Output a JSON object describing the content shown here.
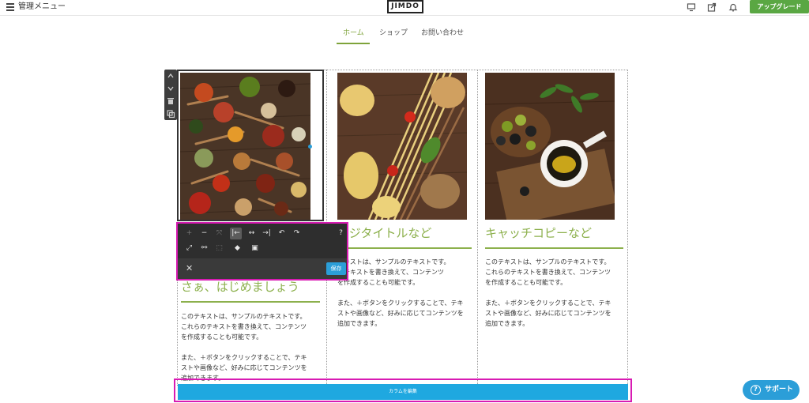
{
  "topbar": {
    "menu_label": "管理メニュー",
    "logo": "JIMDO",
    "upgrade_label": "アップグレード",
    "icons": [
      "hamburger-icon",
      "desktop-preview-icon",
      "share-icon",
      "bell-icon"
    ]
  },
  "nav": {
    "items": [
      "ホーム",
      "ショップ",
      "お問い合わせ"
    ],
    "active_index": 0,
    "active_color": "#7ea33a"
  },
  "columns": [
    {
      "photo": "spices",
      "heading": "さぁ、はじめましょう",
      "paragraphs": [
        "このテキストは、サンプルのテキストです。これらのテキストを書き換えて、コンテンツを作成することも可能です。",
        "また、＋ボタンをクリックすることで、テキストや画像など、好みに応じてコンテンツを追加できます。"
      ]
    },
    {
      "photo": "pasta",
      "heading": "ージタイトルなど",
      "paragraphs": [
        "テキストは、サンプルのテキストです。のテキストを書き換えて、コンテンツを作成することも可能です。",
        "また、＋ボタンをクリックすることで、テキストや画像など、好みに応じてコンテンツを追加できます。"
      ]
    },
    {
      "photo": "olives",
      "heading": "キャッチコピーなど",
      "paragraphs": [
        "このテキストは、サンプルのテキストです。これらのテキストを書き換えて、コンテンツを作成することも可能です。",
        "また、＋ボタンをクリックすることで、テキストや画像など、好みに応じてコンテンツを追加できます。"
      ]
    }
  ],
  "col2_lines": {
    "p1": [
      "テキストは、サンプルのテキストです。",
      "のテキストを書き換えて、コンテンツ",
      "を作成することも可能です。"
    ],
    "p2": [
      "また、＋ボタンをクリックすることで、テキ",
      "ストや画像など、好みに応じてコンテンツを",
      "追加できます。"
    ]
  },
  "col1_lines": {
    "p1": [
      "このテキストは、サンプルのテキストです。",
      "これらのテキストを書き換えて、コンテンツ",
      "を作成することも可能です。"
    ],
    "p2": [
      "また、＋ボタンをクリックすることで、テキ",
      "ストや画像など、好みに応じてコンテンツを",
      "追加できます。"
    ]
  },
  "col3_lines": {
    "p1": [
      "このテキストは、サンプルのテキストです。",
      "これらのテキストを書き換えて、コンテンツ",
      "を作成することも可能です。"
    ],
    "p2": [
      "また、＋ボタンをクリックすることで、テキ",
      "ストや画像など、好みに応じてコンテンツを",
      "追加できます。"
    ]
  },
  "side_toolbar": {
    "icons": [
      "move-up-icon",
      "move-down-icon",
      "delete-icon",
      "copy-icon"
    ]
  },
  "edit_toolbar": {
    "row1": [
      {
        "icon": "zoom-in-icon",
        "glyph": "+",
        "state": "disabled"
      },
      {
        "icon": "zoom-out-icon",
        "glyph": "−",
        "state": "normal"
      },
      {
        "icon": "fit-icon",
        "glyph": "⤧",
        "state": "disabled"
      },
      {
        "icon": "align-left-icon",
        "glyph": "|←",
        "state": "active"
      },
      {
        "icon": "align-center-icon",
        "glyph": "↔",
        "state": "normal"
      },
      {
        "icon": "align-right-icon",
        "glyph": "→|",
        "state": "normal"
      },
      {
        "icon": "rotate-left-icon",
        "glyph": "↶",
        "state": "normal"
      },
      {
        "icon": "rotate-right-icon",
        "glyph": "↷",
        "state": "normal"
      },
      {
        "icon": "help-icon",
        "glyph": "?",
        "state": "normal"
      }
    ],
    "row2": [
      {
        "icon": "resize-icon",
        "glyph": "⤢",
        "state": "normal"
      },
      {
        "icon": "link-icon",
        "glyph": "⚯",
        "state": "normal"
      },
      {
        "icon": "crop-icon",
        "glyph": "⬚",
        "state": "disabled"
      },
      {
        "icon": "tag-icon",
        "glyph": "◆",
        "state": "normal"
      },
      {
        "icon": "caption-icon",
        "glyph": "▣",
        "state": "normal"
      }
    ],
    "close_glyph": "✕",
    "save_label": "保存"
  },
  "column_edit_label": "カラムを編集",
  "support_label": "サポート",
  "support_glyph": "?",
  "accent_colors": {
    "green": "#8cb04c",
    "blue": "#1fa8e0",
    "highlight": "#d81bb3",
    "upgrade": "#5aa743"
  }
}
